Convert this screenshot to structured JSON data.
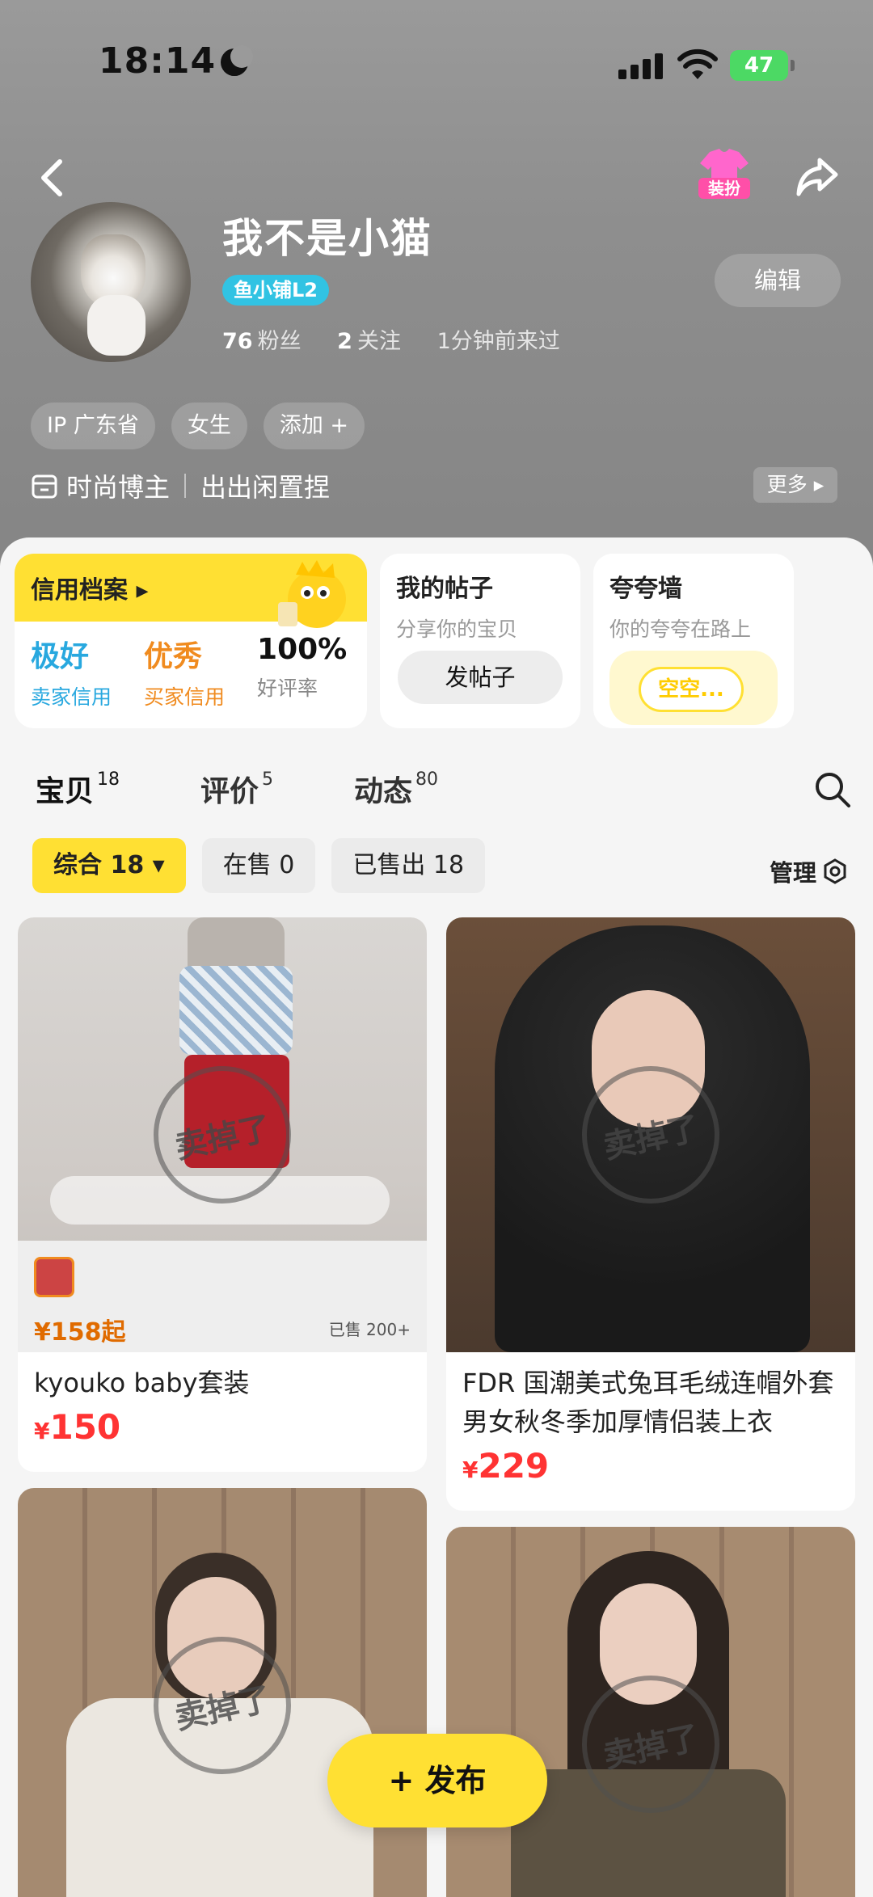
{
  "status_bar": {
    "time": "18:14",
    "battery": "47"
  },
  "profile": {
    "name": "我不是小猫",
    "badge": "鱼小铺L2",
    "fans_count": "76",
    "fans_label": "粉丝",
    "follow_count": "2",
    "follow_label": "关注",
    "last_seen": "1分钟前来过",
    "edit_label": "编辑",
    "tags": [
      "IP 广东省",
      "女生",
      "添加 +"
    ],
    "bio_role": "时尚博主",
    "bio_text": "出出闲置捏",
    "more_label": "更多"
  },
  "credit_card": {
    "title": "信用档案",
    "seller_value": "极好",
    "seller_label": "卖家信用",
    "buyer_value": "优秀",
    "buyer_label": "买家信用",
    "rating_value": "100%",
    "rating_label": "好评率"
  },
  "posts_card": {
    "title": "我的帖子",
    "subtitle": "分享你的宝贝",
    "button": "发帖子"
  },
  "wall_card": {
    "title": "夸夸墙",
    "subtitle": "你的夸夸在路上",
    "empty": "空空..."
  },
  "tabs": [
    {
      "label": "宝贝",
      "count": "18"
    },
    {
      "label": "评价",
      "count": "5"
    },
    {
      "label": "动态",
      "count": "80"
    }
  ],
  "filters": [
    "综合 18",
    "在售 0",
    "已售出 18"
  ],
  "manage_label": "管理",
  "products": [
    {
      "title": "kyouko baby套装",
      "price": "150",
      "stamp": "卖掉了"
    },
    {
      "title": "FDR 国潮美式兔耳毛绒连帽外套男女秋冬季加厚情侣装上衣",
      "price": "229",
      "stamp": "卖掉了"
    },
    {
      "title": "",
      "price": "",
      "stamp": "卖掉了"
    },
    {
      "title": "",
      "price": "",
      "stamp": "卖掉了"
    }
  ],
  "currency": "¥",
  "fab_label": "+ 发布",
  "colors": {
    "accent": "#ffe033",
    "price": "#ff3333",
    "badge": "#31c3e3"
  }
}
